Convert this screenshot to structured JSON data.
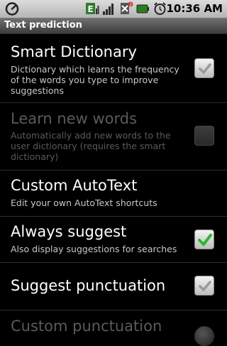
{
  "status_bar": {
    "time": "10:36 AM",
    "icons": [
      "usb-debug-icon",
      "signal-e-icon",
      "signal-strength-icon",
      "no-sim-icon",
      "battery-icon",
      "alarm-icon"
    ],
    "badge_e": "E",
    "badge_x": "2"
  },
  "header": {
    "title": "Text prediction"
  },
  "prefs": [
    {
      "title": "Smart Dictionary",
      "summary": "Dictionary which learns the frequency of the words you type to improve suggestions",
      "checked": true,
      "enabled": true
    },
    {
      "title": "Learn new words",
      "summary": "Automatically add new words to the user dictionary (requires the smart dictionary)",
      "checked": false,
      "enabled": false
    },
    {
      "title": "Custom AutoText",
      "summary": "Edit your own AutoText shortcuts"
    },
    {
      "title": "Always suggest",
      "summary": "Also display suggestions for searches",
      "checked": true,
      "enabled": true
    },
    {
      "title": "Suggest punctuation",
      "checked": true,
      "enabled": true
    },
    {
      "title": "Custom punctuation",
      "enabled": false
    }
  ],
  "colors": {
    "accent_check": "#2fb52f",
    "check_gray": "#9a9a9a"
  }
}
